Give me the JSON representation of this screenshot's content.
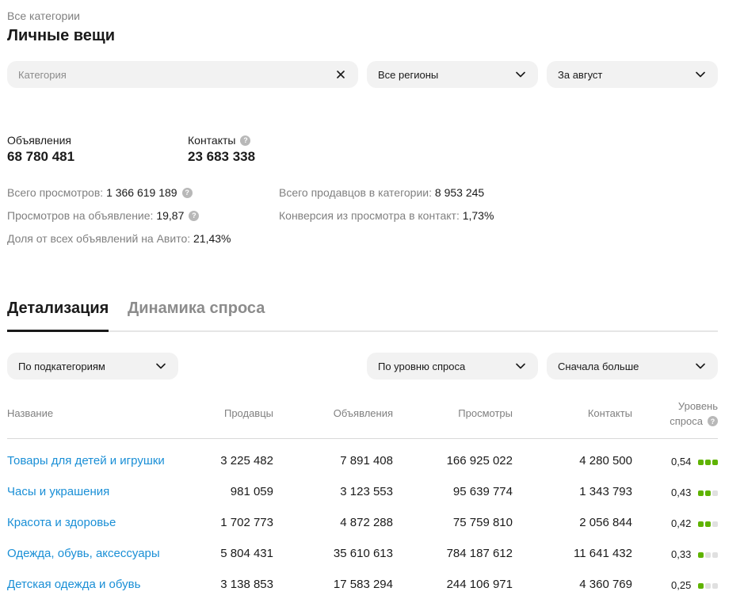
{
  "header": {
    "breadcrumb": "Все категории",
    "title": "Личные вещи"
  },
  "filters": {
    "category_placeholder": "Категория",
    "region": "Все регионы",
    "period": "За август"
  },
  "summary": {
    "listings_label": "Объявления",
    "listings_value": "68 780 481",
    "contacts_label": "Контакты",
    "contacts_value": "23 683 338"
  },
  "metrics": {
    "views_label": "Всего просмотров:",
    "views_value": "1 366 619 189",
    "views_per_listing_label": "Просмотров на объявление:",
    "views_per_listing_value": "19,87",
    "share_label": "Доля от всех объявлений на Авито:",
    "share_value": "21,43%",
    "sellers_label": "Всего продавцов в категории:",
    "sellers_value": "8 953 245",
    "conversion_label": "Конверсия из просмотра в контакт:",
    "conversion_value": "1,73%"
  },
  "tabs": [
    {
      "label": "Детализация",
      "active": true
    },
    {
      "label": "Динамика спроса",
      "active": false
    }
  ],
  "table_filters": {
    "grouping": "По подкатегориям",
    "sort_by": "По уровню спроса",
    "order": "Сначала больше"
  },
  "table": {
    "columns": {
      "name": "Название",
      "sellers": "Продавцы",
      "listings": "Объявления",
      "views": "Просмотры",
      "contacts": "Контакты",
      "demand_line1": "Уровень",
      "demand_line2": "спроса"
    },
    "rows": [
      {
        "name": "Товары для детей и игрушки",
        "sellers": "3 225 482",
        "listings": "7 891 408",
        "views": "166 925 022",
        "contacts": "4 280 500",
        "demand": "0,54",
        "demand_level": 3
      },
      {
        "name": "Часы и украшения",
        "sellers": "981 059",
        "listings": "3 123 553",
        "views": "95 639 774",
        "contacts": "1 343 793",
        "demand": "0,43",
        "demand_level": 2
      },
      {
        "name": "Красота и здоровье",
        "sellers": "1 702 773",
        "listings": "4 872 288",
        "views": "75 759 810",
        "contacts": "2 056 844",
        "demand": "0,42",
        "demand_level": 2
      },
      {
        "name": "Одежда, обувь, аксессуары",
        "sellers": "5 804 431",
        "listings": "35 610 613",
        "views": "784 187 612",
        "contacts": "11 641 432",
        "demand": "0,33",
        "demand_level": 1
      },
      {
        "name": "Детская одежда и обувь",
        "sellers": "3 138 853",
        "listings": "17 583 294",
        "views": "244 106 971",
        "contacts": "4 360 769",
        "demand": "0,25",
        "demand_level": 1
      }
    ]
  },
  "colors": {
    "link": "#1a8fd6",
    "demand_on": "#5fb300",
    "demand_off": "#e0e0e0",
    "field_bg": "#f2f2f2"
  }
}
